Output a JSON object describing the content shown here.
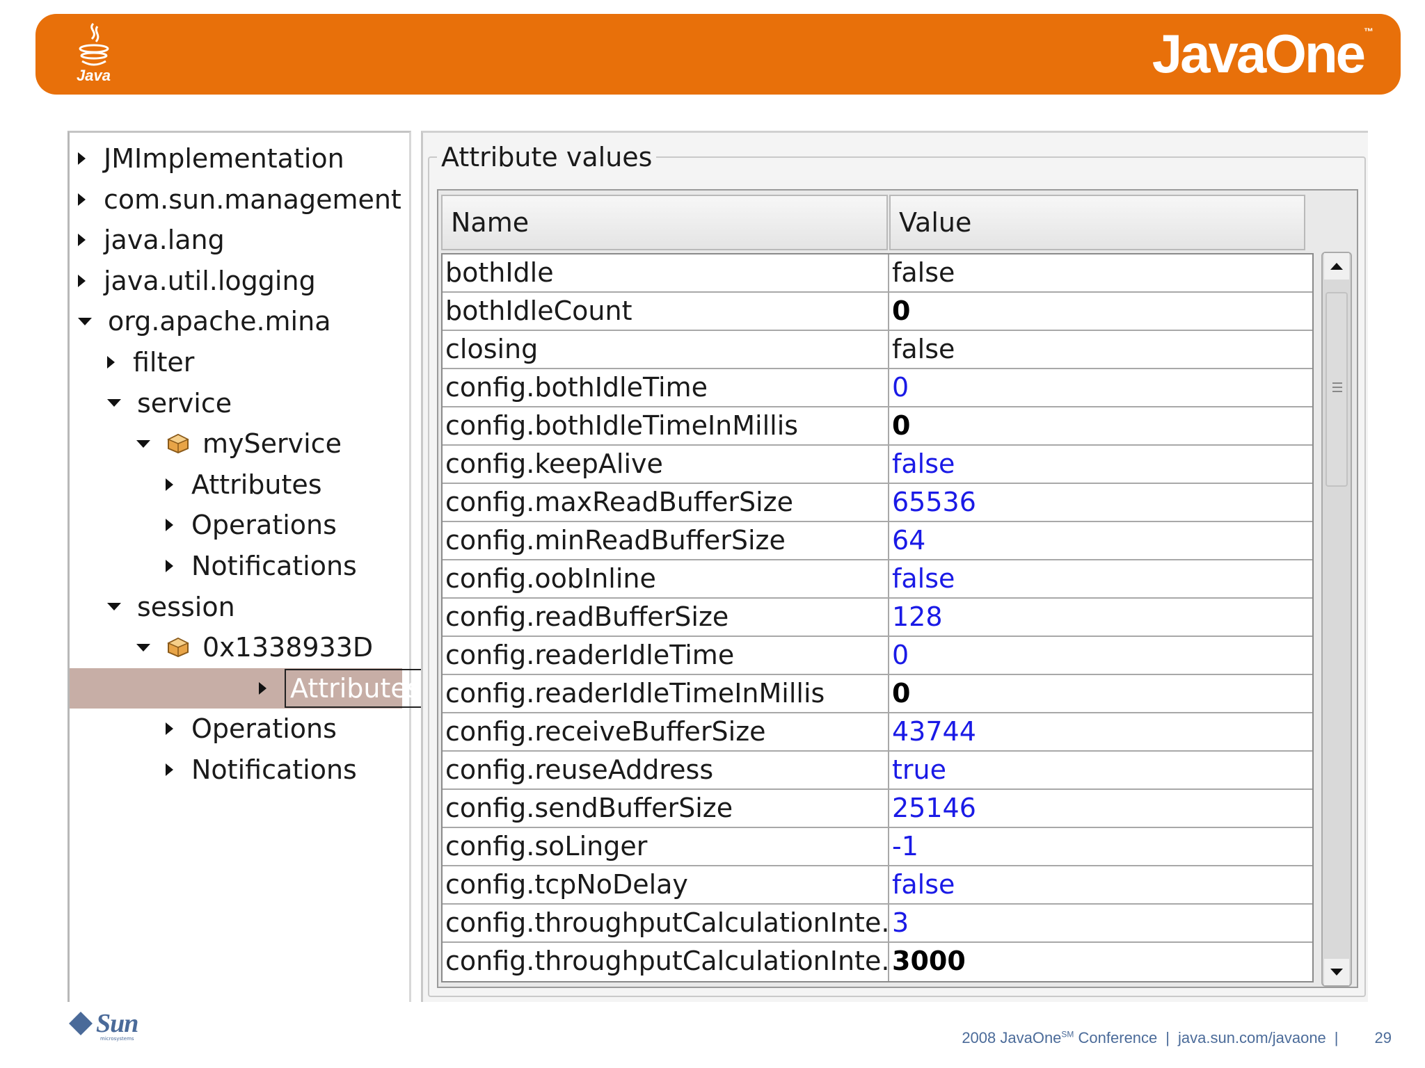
{
  "header": {
    "java_logo_text": "Java",
    "brand": "JavaOne",
    "brand_mark": "™"
  },
  "tree": {
    "items": [
      {
        "label": "JMImplementation",
        "level": 0,
        "expanded": false
      },
      {
        "label": "com.sun.management",
        "level": 0,
        "expanded": false
      },
      {
        "label": "java.lang",
        "level": 0,
        "expanded": false
      },
      {
        "label": "java.util.logging",
        "level": 0,
        "expanded": false
      },
      {
        "label": "org.apache.mina",
        "level": 0,
        "expanded": true
      },
      {
        "label": "filter",
        "level": 1,
        "expanded": false
      },
      {
        "label": "service",
        "level": 1,
        "expanded": true
      },
      {
        "label": "myService",
        "level": 2,
        "expanded": true,
        "icon": "mbean-icon"
      },
      {
        "label": "Attributes",
        "level": 3,
        "expanded": false
      },
      {
        "label": "Operations",
        "level": 3,
        "expanded": false
      },
      {
        "label": "Notifications",
        "level": 3,
        "expanded": false
      },
      {
        "label": "session",
        "level": 1,
        "expanded": true
      },
      {
        "label": "0x1338933D",
        "level": 2,
        "expanded": true,
        "icon": "mbean-icon"
      },
      {
        "label": "Attributes",
        "level": 3,
        "expanded": false,
        "selected": true
      },
      {
        "label": "Operations",
        "level": 3,
        "expanded": false
      },
      {
        "label": "Notifications",
        "level": 3,
        "expanded": false
      }
    ]
  },
  "attributes": {
    "group_title": "Attribute values",
    "columns": {
      "name": "Name",
      "value": "Value"
    },
    "rows": [
      {
        "name": "bothIdle",
        "value": "false",
        "style": "black"
      },
      {
        "name": "bothIdleCount",
        "value": "0",
        "style": "bold"
      },
      {
        "name": "closing",
        "value": "false",
        "style": "black"
      },
      {
        "name": "config.bothIdleTime",
        "value": "0",
        "style": "blue"
      },
      {
        "name": "config.bothIdleTimeInMillis",
        "value": "0",
        "style": "bold"
      },
      {
        "name": "config.keepAlive",
        "value": "false",
        "style": "blue"
      },
      {
        "name": "config.maxReadBufferSize",
        "value": "65536",
        "style": "blue"
      },
      {
        "name": "config.minReadBufferSize",
        "value": "64",
        "style": "blue"
      },
      {
        "name": "config.oobInline",
        "value": "false",
        "style": "blue"
      },
      {
        "name": "config.readBufferSize",
        "value": "128",
        "style": "blue"
      },
      {
        "name": "config.readerIdleTime",
        "value": "0",
        "style": "blue"
      },
      {
        "name": "config.readerIdleTimeInMillis",
        "value": "0",
        "style": "bold"
      },
      {
        "name": "config.receiveBufferSize",
        "value": "43744",
        "style": "blue"
      },
      {
        "name": "config.reuseAddress",
        "value": "true",
        "style": "blue"
      },
      {
        "name": "config.sendBufferSize",
        "value": "25146",
        "style": "blue"
      },
      {
        "name": "config.soLinger",
        "value": "-1",
        "style": "blue"
      },
      {
        "name": "config.tcpNoDelay",
        "value": "false",
        "style": "blue"
      },
      {
        "name": "config.throughputCalculationInte...",
        "value": "3",
        "style": "blue"
      },
      {
        "name": "config.throughputCalculationInte...",
        "value": "3000",
        "style": "bold"
      }
    ]
  },
  "footer": {
    "sun_logo": "Sun",
    "sun_sub": "microsystems",
    "conference_prefix": "2008 JavaOne",
    "conference_sup": "SM",
    "conference_suffix": " Conference",
    "url": "java.sun.com/javaone",
    "page_number": "29"
  },
  "colors": {
    "banner": "#e8700a",
    "selection": "#c7aea6",
    "value_blue": "#1a1ae6",
    "footer_text": "#4b6b99"
  }
}
